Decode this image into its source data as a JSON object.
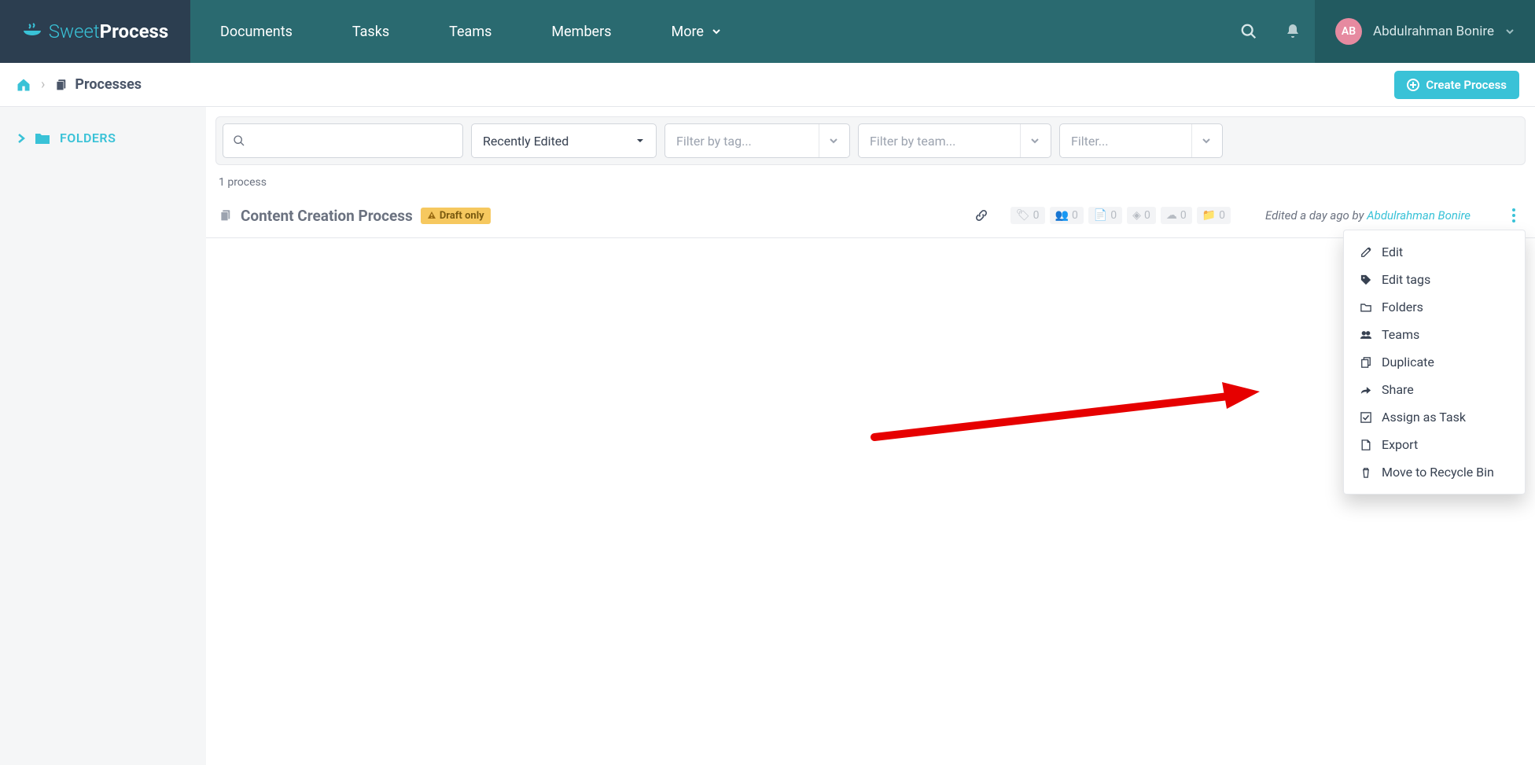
{
  "brand": {
    "sweet": "Sweet",
    "process": "Process"
  },
  "nav": {
    "documents": "Documents",
    "tasks": "Tasks",
    "teams": "Teams",
    "members": "Members",
    "more": "More"
  },
  "user": {
    "initials": "AB",
    "name": "Abdulrahman Bonire"
  },
  "breadcrumb": {
    "page": "Processes"
  },
  "create_button": "Create Process",
  "sidebar": {
    "folders": "FOLDERS"
  },
  "filters": {
    "sort": "Recently Edited",
    "tag_placeholder": "Filter by tag...",
    "team_placeholder": "Filter by team...",
    "filter_placeholder": "Filter..."
  },
  "count_text": "1 process",
  "process": {
    "title": "Content Creation Process",
    "badge": "Draft only",
    "stats": {
      "tags": "0",
      "users": "0",
      "docs": "0",
      "diamond": "0",
      "views": "0",
      "folders": "0"
    },
    "edited_prefix": "Edited a day ago by ",
    "edited_by_name": "Abdulrahman Bonire"
  },
  "menu": {
    "edit": "Edit",
    "edit_tags": "Edit tags",
    "folders": "Folders",
    "teams": "Teams",
    "duplicate": "Duplicate",
    "share": "Share",
    "assign": "Assign as Task",
    "export": "Export",
    "recycle": "Move to Recycle Bin"
  }
}
